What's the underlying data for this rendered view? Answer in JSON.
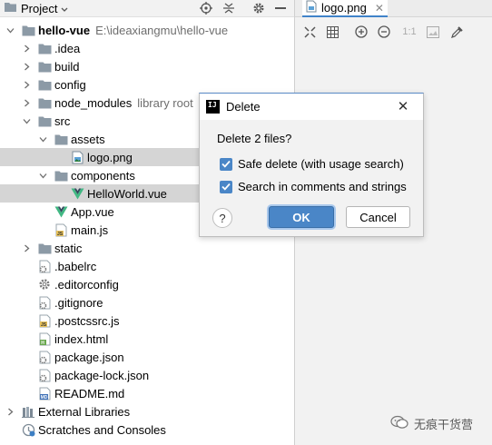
{
  "project_panel": {
    "title": "Project",
    "tree": [
      {
        "label": "hello-vue",
        "path": "E:\\ideaxiangmu\\hello-vue",
        "bold": true,
        "arrow": "down",
        "icon": "folder",
        "depth": 0
      },
      {
        "label": ".idea",
        "arrow": "right",
        "icon": "folder",
        "depth": 1
      },
      {
        "label": "build",
        "arrow": "right",
        "icon": "folder",
        "depth": 1
      },
      {
        "label": "config",
        "arrow": "right",
        "icon": "folder",
        "depth": 1
      },
      {
        "label": "node_modules",
        "path": "library root",
        "arrow": "right",
        "icon": "folder",
        "depth": 1
      },
      {
        "label": "src",
        "arrow": "down",
        "icon": "folder",
        "depth": 1
      },
      {
        "label": "assets",
        "arrow": "down",
        "icon": "folder",
        "depth": 2
      },
      {
        "label": "logo.png",
        "arrow": "none",
        "icon": "image",
        "depth": 3,
        "selected": true
      },
      {
        "label": "components",
        "arrow": "down",
        "icon": "folder",
        "depth": 2
      },
      {
        "label": "HelloWorld.vue",
        "arrow": "none",
        "icon": "vue",
        "depth": 3,
        "selected": true
      },
      {
        "label": "App.vue",
        "arrow": "none",
        "icon": "vue",
        "depth": 2
      },
      {
        "label": "main.js",
        "arrow": "none",
        "icon": "js",
        "depth": 2
      },
      {
        "label": "static",
        "arrow": "right",
        "icon": "folder",
        "depth": 1
      },
      {
        "label": ".babelrc",
        "arrow": "none",
        "icon": "config",
        "depth": 1
      },
      {
        "label": ".editorconfig",
        "arrow": "none",
        "icon": "gear",
        "depth": 1
      },
      {
        "label": ".gitignore",
        "arrow": "none",
        "icon": "config",
        "depth": 1
      },
      {
        "label": ".postcssrc.js",
        "arrow": "none",
        "icon": "js",
        "depth": 1
      },
      {
        "label": "index.html",
        "arrow": "none",
        "icon": "html",
        "depth": 1
      },
      {
        "label": "package.json",
        "arrow": "none",
        "icon": "config",
        "depth": 1
      },
      {
        "label": "package-lock.json",
        "arrow": "none",
        "icon": "config",
        "depth": 1
      },
      {
        "label": "README.md",
        "arrow": "none",
        "icon": "md",
        "depth": 1
      },
      {
        "label": "External Libraries",
        "arrow": "right",
        "icon": "libraries",
        "depth": 0
      },
      {
        "label": "Scratches and Consoles",
        "arrow": "none",
        "icon": "scratches",
        "depth": 0
      }
    ]
  },
  "editor": {
    "tab_label": "logo.png",
    "toolbar_zoom_label": "1:1"
  },
  "dialog": {
    "title": "Delete",
    "question": "Delete 2 files?",
    "checkbox_safe_delete": "Safe delete (with usage search)",
    "checkbox_search_comments": "Search in comments and strings",
    "safe_delete_checked": true,
    "search_comments_checked": true,
    "help_label": "?",
    "ok_label": "OK",
    "cancel_label": "Cancel"
  },
  "watermark": {
    "text": "无痕干货营"
  },
  "colors": {
    "selection": "#d5d5d5",
    "accent": "#4a86c7",
    "folder": "#8c9aa6",
    "vue_green": "#41b883"
  }
}
